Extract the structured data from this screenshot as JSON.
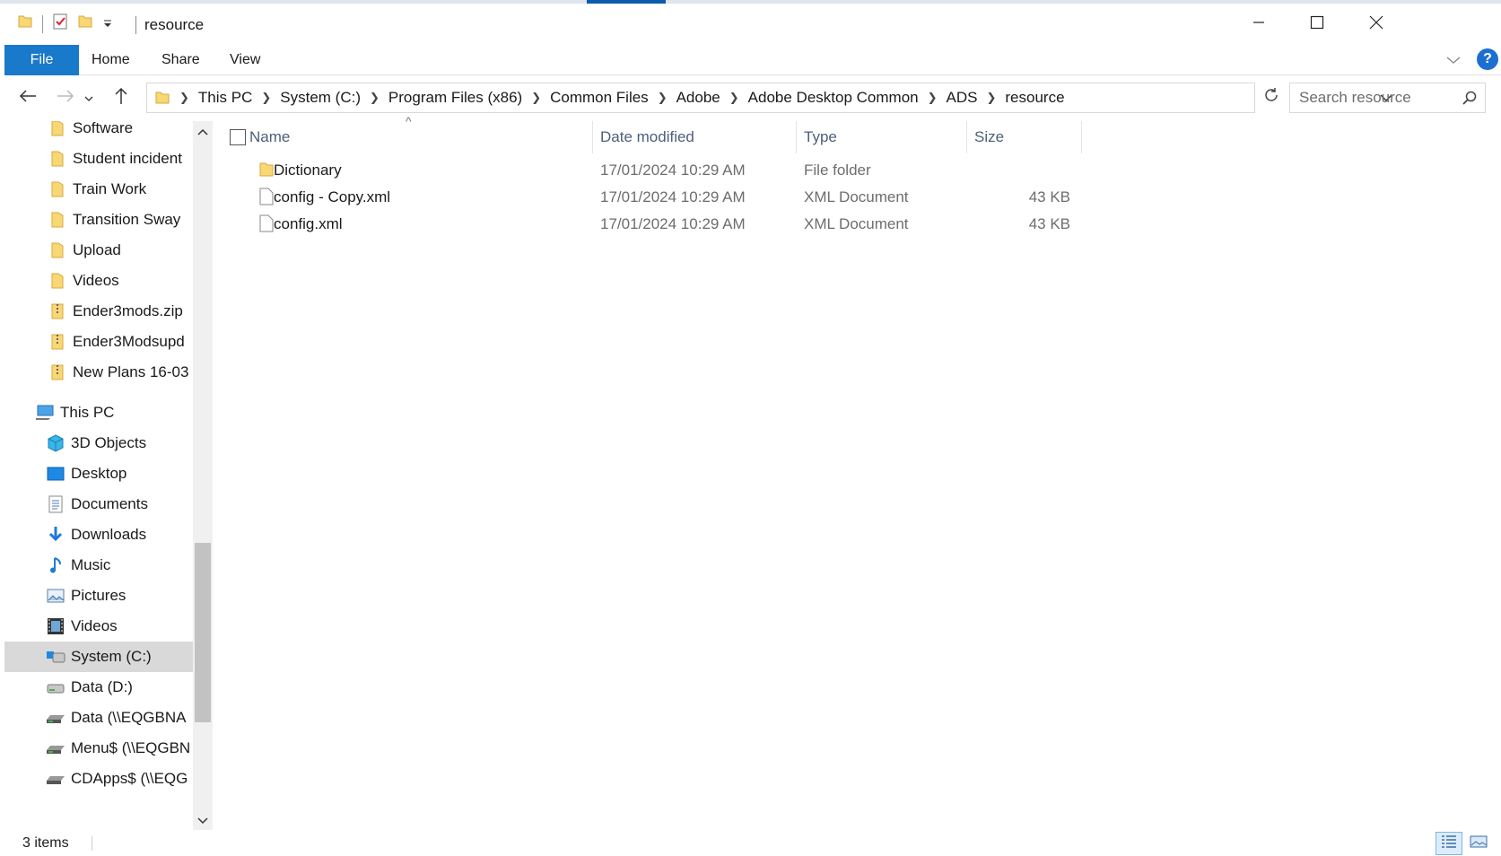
{
  "window": {
    "title": "resource"
  },
  "ribbon": {
    "tabs": [
      {
        "label": "File"
      },
      {
        "label": "Home"
      },
      {
        "label": "Share"
      },
      {
        "label": "View"
      }
    ],
    "help": "?"
  },
  "address": {
    "crumbs": [
      "This PC",
      "System (C:)",
      "Program Files (x86)",
      "Common Files",
      "Adobe",
      "Adobe Desktop Common",
      "ADS",
      "resource"
    ]
  },
  "search": {
    "placeholder": "Search resource"
  },
  "sidebar": {
    "items": [
      {
        "label": "Software",
        "icon": "folder-icon"
      },
      {
        "label": "Student incident",
        "icon": "folder-icon"
      },
      {
        "label": "Train Work",
        "icon": "folder-icon"
      },
      {
        "label": "Transition Sway",
        "icon": "folder-icon"
      },
      {
        "label": "Upload",
        "icon": "folder-icon"
      },
      {
        "label": "Videos",
        "icon": "folder-icon"
      },
      {
        "label": "Ender3mods.zip",
        "icon": "zip-folder-icon"
      },
      {
        "label": "Ender3Modsupd",
        "icon": "zip-folder-icon"
      },
      {
        "label": "New Plans 16-03",
        "icon": "zip-folder-icon"
      },
      {
        "label": "This PC",
        "icon": "this-pc-icon"
      },
      {
        "label": "3D Objects",
        "icon": "3d-objects-icon"
      },
      {
        "label": "Desktop",
        "icon": "desktop-icon"
      },
      {
        "label": "Documents",
        "icon": "documents-icon"
      },
      {
        "label": "Downloads",
        "icon": "downloads-icon"
      },
      {
        "label": "Music",
        "icon": "music-icon"
      },
      {
        "label": "Pictures",
        "icon": "pictures-icon"
      },
      {
        "label": "Videos",
        "icon": "videos-icon"
      },
      {
        "label": "System (C:)",
        "icon": "system-drive-icon"
      },
      {
        "label": "Data (D:)",
        "icon": "drive-icon"
      },
      {
        "label": "Data (\\\\EQGBNA",
        "icon": "network-drive-icon"
      },
      {
        "label": "Menu$ (\\\\EQGBN",
        "icon": "network-drive-icon"
      },
      {
        "label": "CDApps$ (\\\\EQG",
        "icon": "network-drive-icon"
      }
    ]
  },
  "columns": {
    "name": "Name",
    "date": "Date modified",
    "type": "Type",
    "size": "Size"
  },
  "files": [
    {
      "name": "Dictionary",
      "date": "17/01/2024 10:29 AM",
      "type": "File folder",
      "size": "",
      "icon": "folder-icon"
    },
    {
      "name": "config - Copy.xml",
      "date": "17/01/2024 10:29 AM",
      "type": "XML Document",
      "size": "43 KB",
      "icon": "file-icon"
    },
    {
      "name": "config.xml",
      "date": "17/01/2024 10:29 AM",
      "type": "XML Document",
      "size": "43 KB",
      "icon": "file-icon"
    }
  ],
  "status": {
    "count": "3 items"
  },
  "colors": {
    "accent": "#1979ca",
    "folder": "#f8d775",
    "selected": "#d9d9d9"
  }
}
